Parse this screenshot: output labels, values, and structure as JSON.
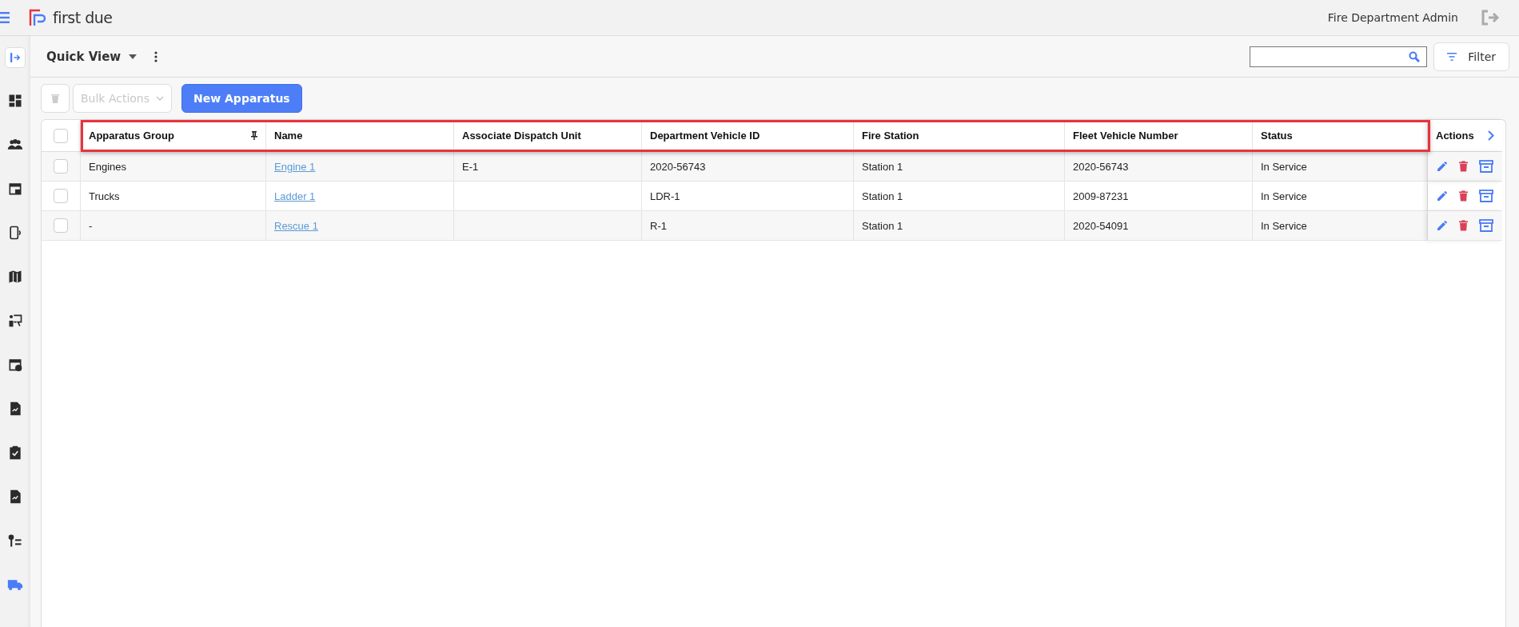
{
  "brand": {
    "name": "first due"
  },
  "user": {
    "name": "Fire Department Admin"
  },
  "sidebar": {
    "items": [
      {
        "kind": "dashboard",
        "selected": false
      },
      {
        "kind": "people",
        "selected": false
      },
      {
        "kind": "calendar",
        "selected": false
      },
      {
        "kind": "device",
        "selected": false
      },
      {
        "kind": "map",
        "selected": false
      },
      {
        "kind": "presenter",
        "selected": false
      },
      {
        "kind": "event",
        "selected": false
      },
      {
        "kind": "report",
        "selected": false
      },
      {
        "kind": "clipboard",
        "selected": false
      },
      {
        "kind": "report",
        "selected": false
      },
      {
        "kind": "keylist",
        "selected": false
      },
      {
        "kind": "truck",
        "selected": true
      }
    ]
  },
  "toolbar": {
    "view": "Quick View",
    "filter": "Filter"
  },
  "actions": {
    "bulk": "Bulk Actions",
    "bulk_disabled": true,
    "delete_disabled": true,
    "new": "New Apparatus"
  },
  "table": {
    "all_checked": false,
    "columns": [
      {
        "label": "Apparatus Group",
        "pinned": true
      },
      {
        "label": "Name",
        "pinned": false
      },
      {
        "label": "Associate Dispatch Unit",
        "pinned": false
      },
      {
        "label": "Department Vehicle ID",
        "pinned": false
      },
      {
        "label": "Fire Station",
        "pinned": false
      },
      {
        "label": "Fleet Vehicle Number",
        "pinned": false
      },
      {
        "label": "Status",
        "pinned": false
      }
    ],
    "actions_label": "Actions",
    "rows": [
      {
        "checked": false,
        "cells": [
          "Engines",
          "Engine 1",
          "E-1",
          "2020-56743",
          "Station 1",
          "2020-56743",
          "In Service"
        ]
      },
      {
        "checked": false,
        "cells": [
          "Trucks",
          "Ladder 1",
          "",
          "LDR-1",
          "Station 1",
          "2009-87231",
          "In Service"
        ]
      },
      {
        "checked": false,
        "cells": [
          "-",
          "Rescue 1",
          "",
          "R-1",
          "Station 1",
          "2020-54091",
          "In Service"
        ]
      }
    ]
  }
}
